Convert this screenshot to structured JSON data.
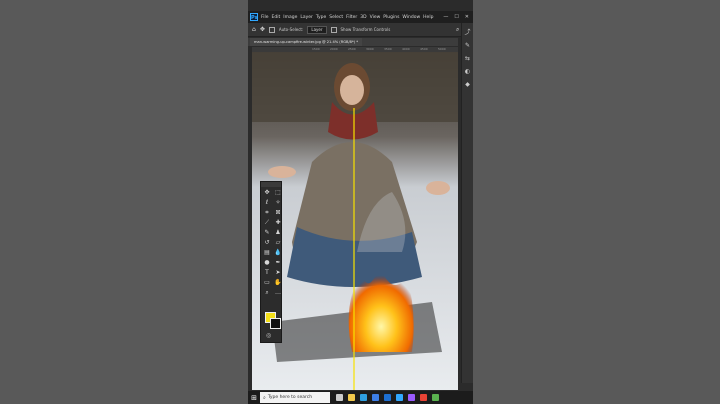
{
  "app": {
    "logo": "Ps",
    "menus": [
      "File",
      "Edit",
      "Image",
      "Layer",
      "Type",
      "Select",
      "Filter",
      "3D",
      "View",
      "Plugins",
      "Window",
      "Help"
    ],
    "window_controls": [
      "—",
      "☐",
      "✕"
    ]
  },
  "options": {
    "auto_select_label": "Auto-Select:",
    "layer_value": "Layer",
    "transform_label": "Show Transform Controls"
  },
  "document": {
    "tab_title": "man-warming-up-campfire-winter.jpg @ 21.4% (RGB/8*) *",
    "ruler_marks": [
      "1500",
      "2000",
      "2500",
      "3000",
      "3500",
      "4000",
      "4500",
      "5000"
    ]
  },
  "taskbar": {
    "start_icon": "⊞",
    "search_placeholder": "Type here to search",
    "icons": [
      {
        "name": "task-view-icon",
        "color": "#cccccc"
      },
      {
        "name": "explorer-icon",
        "color": "#f2c94c"
      },
      {
        "name": "edge-icon",
        "color": "#2f9fe0"
      },
      {
        "name": "store-icon",
        "color": "#3d7ee6"
      },
      {
        "name": "mail-icon",
        "color": "#1d6fd1"
      },
      {
        "name": "photoshop-icon",
        "color": "#31a8ff"
      },
      {
        "name": "premiere-icon",
        "color": "#9a5bff"
      },
      {
        "name": "chrome-icon",
        "color": "#e94335"
      },
      {
        "name": "app-icon",
        "color": "#5ab14f"
      }
    ]
  },
  "colors": {
    "foreground": "#f4e019",
    "background": "#111111",
    "guide": "#f7e200"
  }
}
